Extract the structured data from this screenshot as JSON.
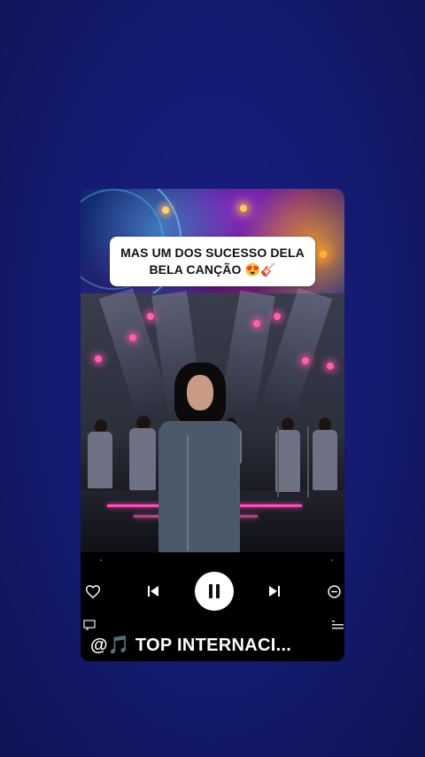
{
  "post": {
    "caption_line1": "MAS UM DOS SUCESSO DELA",
    "caption_line2": "BELA CANÇÃO 😍🎸"
  },
  "player": {
    "like_icon": "heart-icon",
    "prev_icon": "skip-previous-icon",
    "pause_icon": "pause-icon",
    "next_icon": "skip-next-icon",
    "remove_icon": "minus-circle-icon",
    "cast_icon": "cast-icon",
    "queue_icon": "queue-list-icon",
    "channel_name": "@🎵 TOP INTERNACI..."
  },
  "colors": {
    "background": "#161c78",
    "card": "#000000",
    "accent_pink": "#ff4fb8"
  }
}
